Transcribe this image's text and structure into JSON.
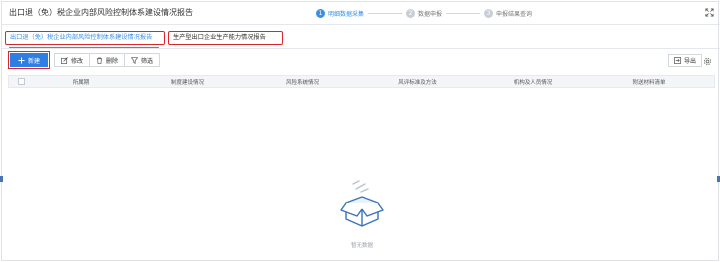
{
  "header": {
    "title": "出口退（免）税企业内部风险控制体系建设情况报告",
    "steps": [
      {
        "num": "1",
        "label": "明细数据采集",
        "state": "active"
      },
      {
        "num": "2",
        "label": "数据申报",
        "state": "inactive"
      },
      {
        "num": "3",
        "label": "申报结果查询",
        "state": "inactive"
      }
    ]
  },
  "tabs": [
    {
      "label": "出口退（免）税企业内部风险控制体系建设情况报告",
      "active": true
    },
    {
      "label": "生产型出口企业生产能力情况报告",
      "active": false
    }
  ],
  "toolbar": {
    "new_label": "新建",
    "edit_label": "修改",
    "delete_label": "删除",
    "filter_label": "筛选",
    "export_label": "导出"
  },
  "table": {
    "columns": [
      "所属期",
      "制度建设情况",
      "风险系统情况",
      "风评标准及方法",
      "机构及人员情况",
      "附送材料清单"
    ]
  },
  "empty": {
    "text": "暂无数据"
  },
  "colors": {
    "accent": "#3b8fe5",
    "primary_button": "#2f7ee3",
    "highlight_border": "#d9262d"
  }
}
